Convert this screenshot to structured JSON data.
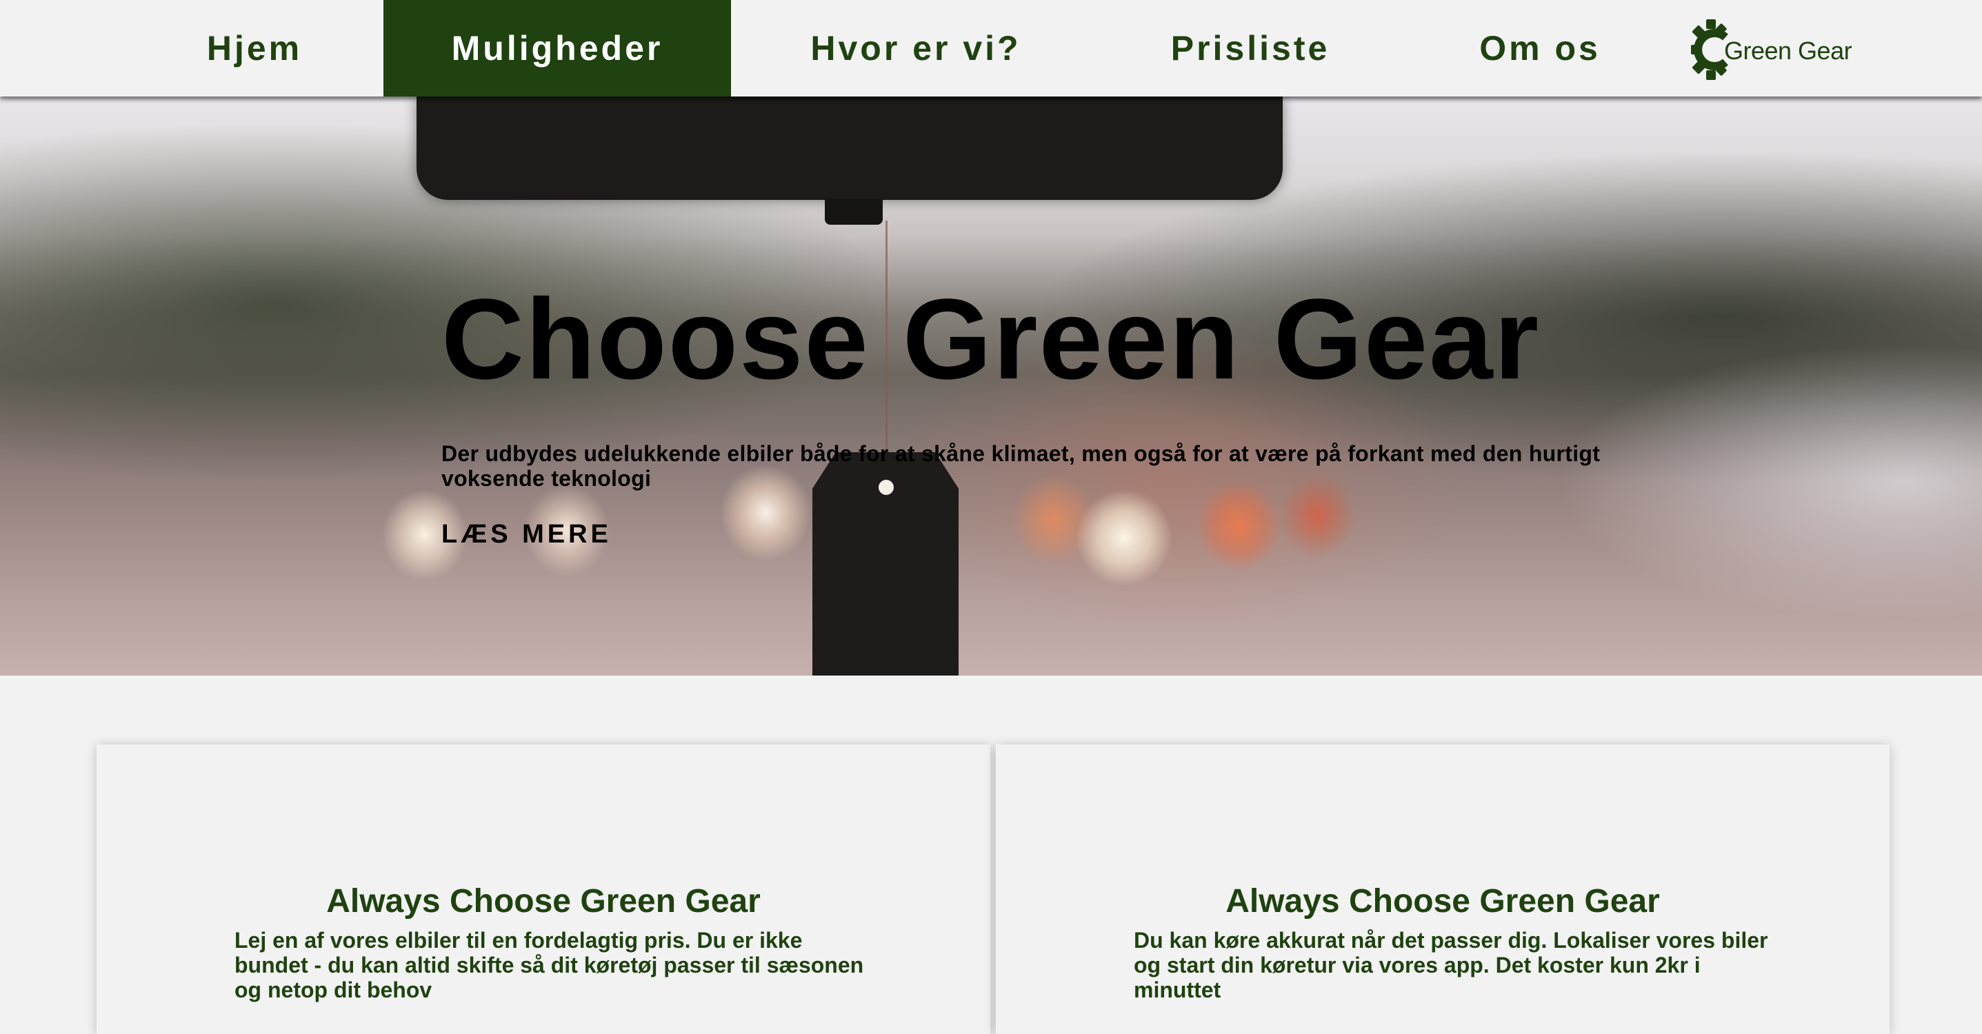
{
  "colors": {
    "brand_green": "#1f4210",
    "nav_active_text": "#ffffff",
    "background": "#f2f2f2"
  },
  "nav": {
    "items": [
      {
        "label": "Hjem",
        "active": false
      },
      {
        "label": "Muligheder",
        "active": true
      },
      {
        "label": "Hvor er vi?",
        "active": false
      },
      {
        "label": "Prisliste",
        "active": false
      },
      {
        "label": "Om os",
        "active": false
      }
    ],
    "logo": {
      "text": "Green Gear",
      "icon": "gear-icon"
    }
  },
  "hero": {
    "title": "Choose Green Gear",
    "text": "Der udbydes udelukkende elbiler både for at skåne klimaet, men også for at være på forkant med den hurtigt voksende teknologi",
    "cta_label": "LÆS MERE"
  },
  "cards": [
    {
      "title": "Always Choose Green Gear",
      "text": "Lej en af vores elbiler til en fordelagtig pris. Du er ikke bundet - du kan altid skifte så dit køretøj passer til sæsonen og netop dit behov"
    },
    {
      "title": "Always Choose Green Gear",
      "text": "Du kan køre akkurat når det passer dig. Lokaliser vores biler og start din køretur via vores app. Det koster kun 2kr i minuttet"
    }
  ]
}
